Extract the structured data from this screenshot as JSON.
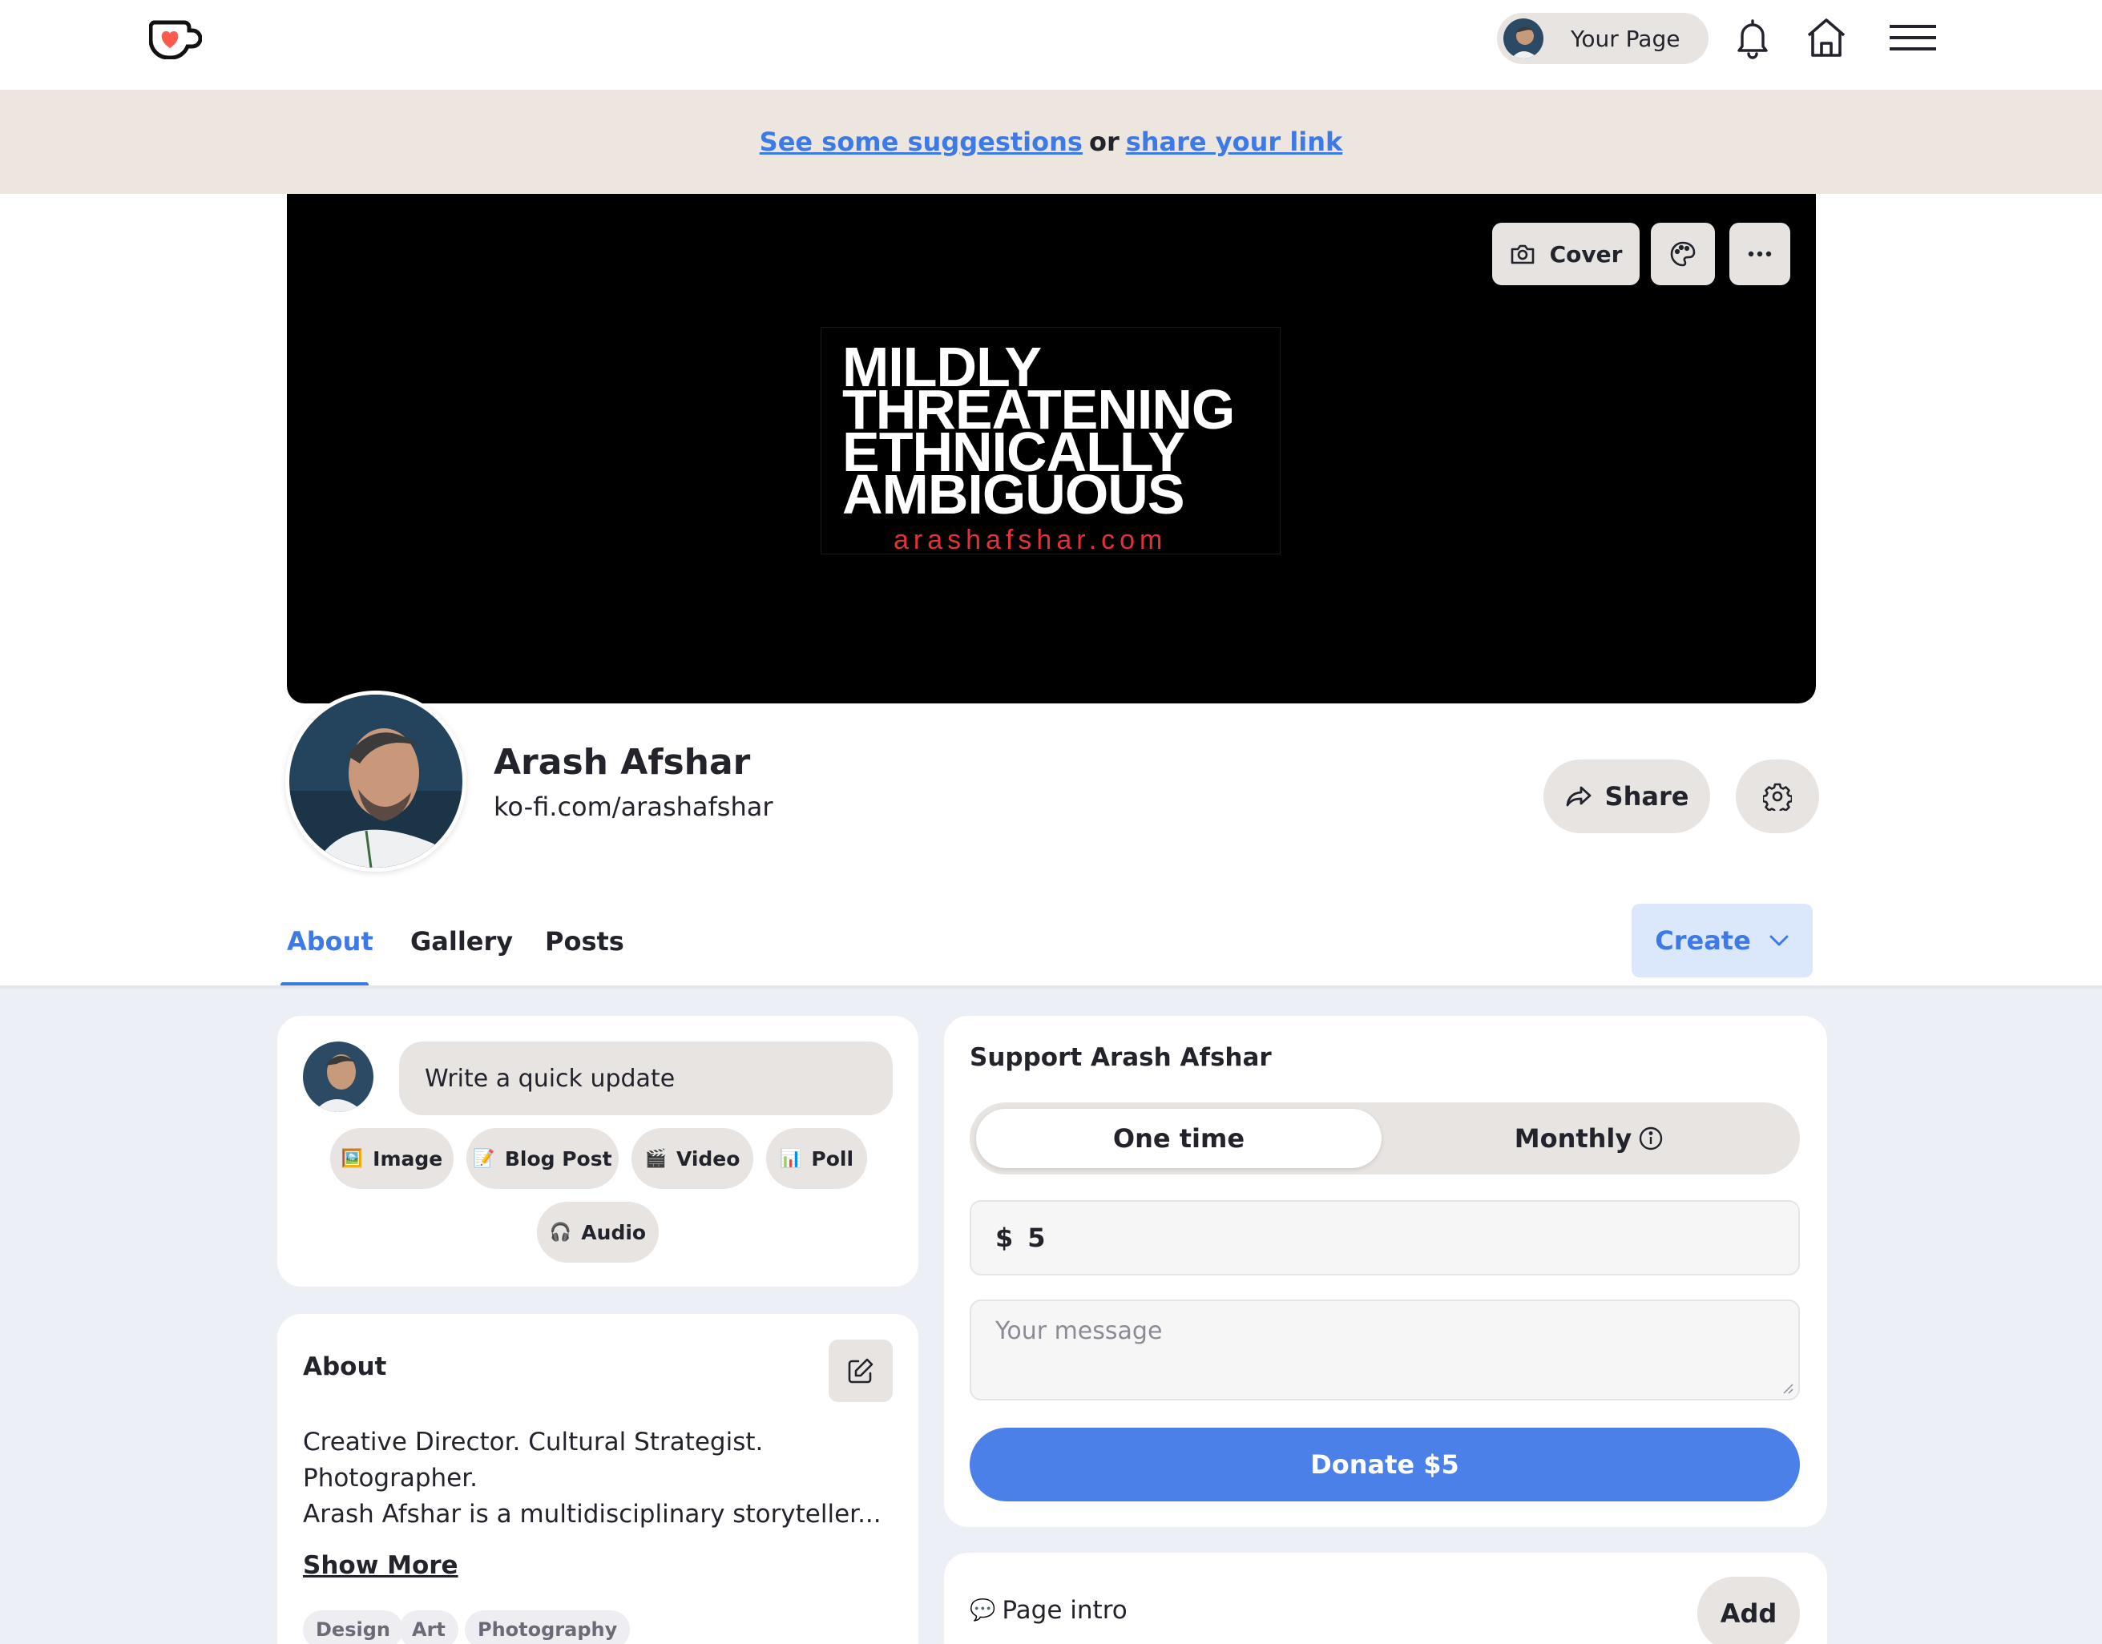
{
  "nav": {
    "your_page_label": "Your Page",
    "icons": [
      "ko-fi-logo",
      "bell-icon",
      "home-icon",
      "hamburger-menu-icon"
    ]
  },
  "banner": {
    "suggestions_link": "See some suggestions",
    "or": "or",
    "share_link": "share your link"
  },
  "cover": {
    "cover_button": "Cover",
    "art_lines": [
      "MILDLY",
      "THREATENING",
      "ETHNICALLY",
      "AMBIGUOUS"
    ],
    "art_url": "arashafshar.com"
  },
  "profile": {
    "name": "Arash Afshar",
    "url": "ko-fi.com/arashafshar",
    "share_label": "Share"
  },
  "tabs": [
    {
      "label": "About",
      "active": true
    },
    {
      "label": "Gallery",
      "active": false
    },
    {
      "label": "Posts",
      "active": false
    }
  ],
  "create_label": "Create",
  "quick_update": {
    "placeholder": "Write a quick update",
    "actions": [
      {
        "icon": "🖼️",
        "label": "Image"
      },
      {
        "icon": "📝",
        "label": "Blog Post"
      },
      {
        "icon": "🎬",
        "label": "Video"
      },
      {
        "icon": "📊",
        "label": "Poll"
      },
      {
        "icon": "🎧",
        "label": "Audio"
      }
    ]
  },
  "about": {
    "heading": "About",
    "lines": [
      "Creative Director. Cultural Strategist.",
      "Photographer.",
      "Arash Afshar is a multidisciplinary storyteller..."
    ],
    "show_more": "Show More",
    "tags": [
      "Design",
      "Art",
      "Photography"
    ]
  },
  "support": {
    "heading": "Support Arash Afshar",
    "one_time": "One time",
    "monthly": "Monthly",
    "currency": "$",
    "amount": "5",
    "message_placeholder": "Your message",
    "donate_label": "Donate $5"
  },
  "page_intro": {
    "icon": "💬",
    "label": "Page intro",
    "add_label": "Add"
  },
  "colors": {
    "accent": "#3d7ae6",
    "donate": "#4a80e8",
    "banner_bg": "#ede6df",
    "content_bg": "#eceff6"
  }
}
